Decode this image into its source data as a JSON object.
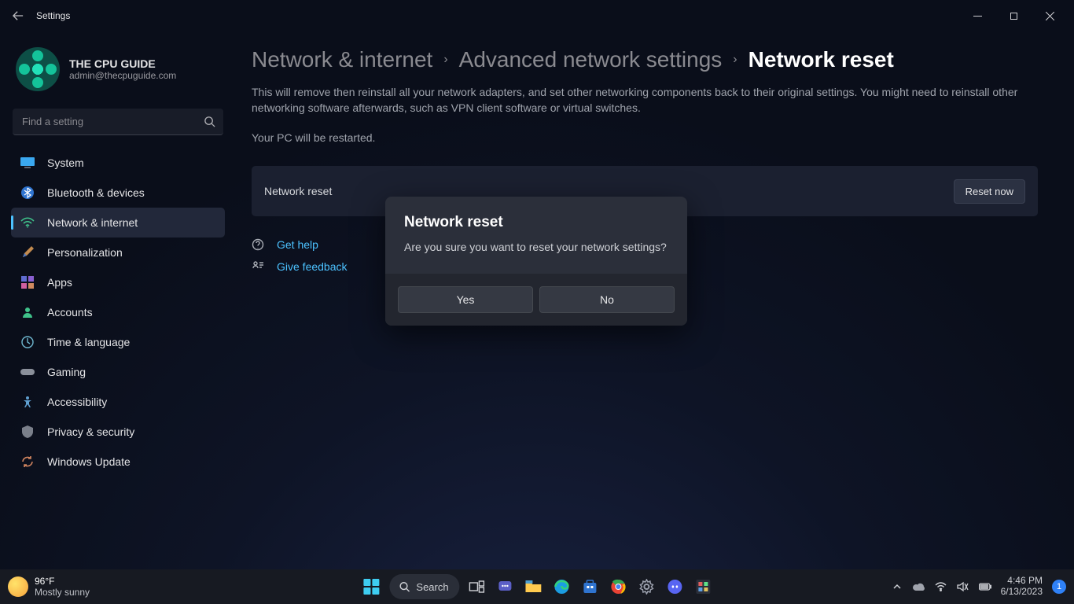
{
  "titlebar": {
    "title": "Settings"
  },
  "profile": {
    "name": "THE CPU GUIDE",
    "email": "admin@thecpuguide.com"
  },
  "search": {
    "placeholder": "Find a setting"
  },
  "sidebar": {
    "items": [
      {
        "label": "System"
      },
      {
        "label": "Bluetooth & devices"
      },
      {
        "label": "Network & internet"
      },
      {
        "label": "Personalization"
      },
      {
        "label": "Apps"
      },
      {
        "label": "Accounts"
      },
      {
        "label": "Time & language"
      },
      {
        "label": "Gaming"
      },
      {
        "label": "Accessibility"
      },
      {
        "label": "Privacy & security"
      },
      {
        "label": "Windows Update"
      }
    ]
  },
  "breadcrumb": {
    "part1": "Network & internet",
    "part2": "Advanced network settings",
    "current": "Network reset"
  },
  "main": {
    "description": "This will remove then reinstall all your network adapters, and set other networking components back to their original settings. You might need to reinstall other networking software afterwards, such as VPN client software or virtual switches.",
    "restart_note": "Your PC will be restarted.",
    "card_label": "Network reset",
    "reset_button": "Reset now"
  },
  "links": {
    "help": "Get help",
    "feedback": "Give feedback"
  },
  "dialog": {
    "title": "Network reset",
    "message": "Are you sure you want to reset your network settings?",
    "yes": "Yes",
    "no": "No"
  },
  "taskbar": {
    "temperature": "96°F",
    "condition": "Mostly sunny",
    "search_label": "Search",
    "time": "4:46 PM",
    "date": "6/13/2023",
    "badge_count": "1"
  }
}
